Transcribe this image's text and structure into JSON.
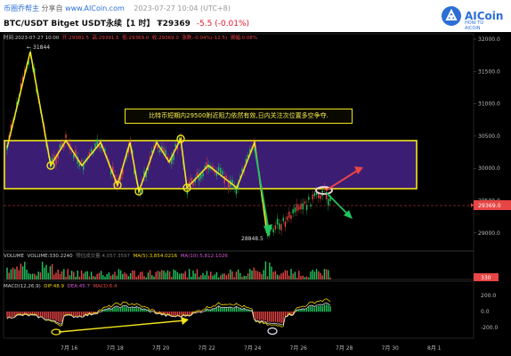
{
  "topbar": {
    "brand": "币圈乔帮主",
    "share": "分享自",
    "share_site": "www.AICoin.com",
    "time": "2023-07-27 10:04 (UTC+8)",
    "pair": "BTC/USDT Bitget USDT永续【1 时】",
    "price": "₮29369",
    "change": "-5.5 (-0.01%)",
    "logo_text": "AICoin",
    "logo_sub": "HOW TO AICOIN"
  },
  "info": {
    "time_label": "时间:2023-07-27 10:00",
    "open": "开:29381.5",
    "high": "高:29391.5",
    "low": "低:29369.0",
    "close": "收:29369.0",
    "change": "涨跌:-0.04%(-12.5)",
    "amplitude": "振幅:0.08%"
  },
  "chart": {
    "high_label": "31844",
    "low_label": "28848.5",
    "annotation": "比特币短期内29500附近阻力依然有效,日内关注次位置多空争夺.",
    "current_price_tag": "29369.0",
    "y_ticks": [
      "32000.0",
      "31500.0",
      "31000.0",
      "30500.0",
      "30000.0",
      "29500.0",
      "29000.0"
    ],
    "x_ticks": [
      "7月 16",
      "7月 18",
      "7月 20",
      "7月 22",
      "7月 24",
      "7月 26",
      "7月 28",
      "7月 30",
      "8月 1"
    ]
  },
  "volume": {
    "label": "VOLUME",
    "volume": "VOLUME:330.2240",
    "predicted": "预估成交量:4,057.3597",
    "ma5": "MA(5):3,854.0216",
    "ma10": "MA(10):5,812.1026",
    "tag": "330"
  },
  "macd": {
    "label": "MACD(12,26,9)",
    "dif": "DIF:48.9",
    "dea": "DEA:45.7",
    "macd": "MACD:6.4",
    "y_ticks": [
      "200.0",
      "0.0",
      "-200.0"
    ]
  },
  "colors": {
    "up": "#e84545",
    "down": "#22c55e",
    "annotation": "#f3e41e",
    "box_fill": "#3b1d74",
    "accent": "#2b6fd6"
  }
}
